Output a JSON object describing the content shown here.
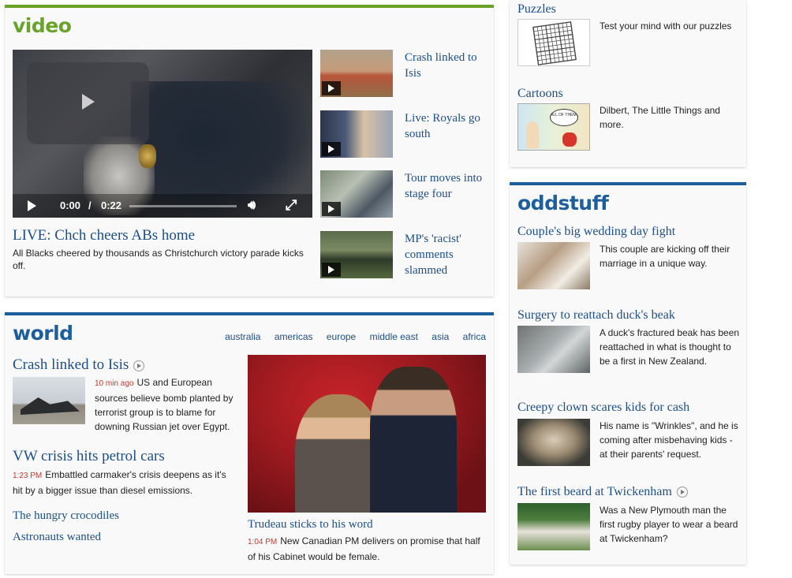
{
  "video": {
    "section_title": "video",
    "player": {
      "current_time": "0:00",
      "separator": "/",
      "duration": "0:22"
    },
    "headline": "LIVE: Chch cheers ABs home",
    "description": "All Blacks cheered by thousands as Christchurch victory parade kicks off.",
    "items": [
      {
        "title": "Crash linked to Isis"
      },
      {
        "title": "Live: Royals go south"
      },
      {
        "title": "Tour moves into stage four"
      },
      {
        "title": "MP's 'racist' comments slammed"
      }
    ]
  },
  "world": {
    "section_title": "world",
    "links": [
      "australia",
      "americas",
      "europe",
      "middle east",
      "asia",
      "africa"
    ],
    "stories": [
      {
        "title": "Crash linked to Isis",
        "time": "10 min ago",
        "text": "US and European sources believe bomb planted by terrorist group is to blame for downing Russian jet over Egypt."
      },
      {
        "title": "VW crisis hits petrol cars",
        "time": "1:23 PM",
        "text": "Embattled carmaker's crisis deepens as it's hit by a bigger issue than diesel emissions."
      }
    ],
    "more_links": [
      "The hungry crocodiles",
      "Astronauts wanted"
    ],
    "feature": {
      "caption": "Trudeau sticks to his word",
      "time": "1:04 PM",
      "text": "New Canadian PM delivers on promise that half of his Cabinet would be female."
    }
  },
  "sidebar": {
    "puzzles": {
      "title": "Puzzles",
      "text": "Test your mind with our puzzles"
    },
    "cartoons": {
      "title": "Cartoons",
      "text": "Dilbert, The Little Things and more.",
      "bubble": "ALL OF THEM."
    }
  },
  "oddstuff": {
    "section_title": "oddstuff",
    "items": [
      {
        "title": "Couple's big wedding day fight",
        "text": "This couple are kicking off their marriage in a unique way."
      },
      {
        "title": "Surgery to reattach duck's beak",
        "text": "A duck's fractured beak has been reattached in what is thought to be a first in New Zealand."
      },
      {
        "title": "Creepy clown scares kids for cash",
        "text": "His name is \"Wrinkles\", and he is coming after misbehaving kids - at their parents' request."
      },
      {
        "title": "The first beard at Twickenham",
        "text": "Was a New Plymouth man the first rugby player to wear a beard at Twickenham?"
      }
    ]
  },
  "colors": {
    "video_accent": "#6aa32a",
    "world_accent": "#1d5f9c",
    "link": "#1d4f86",
    "time_red": "#c0392b"
  }
}
